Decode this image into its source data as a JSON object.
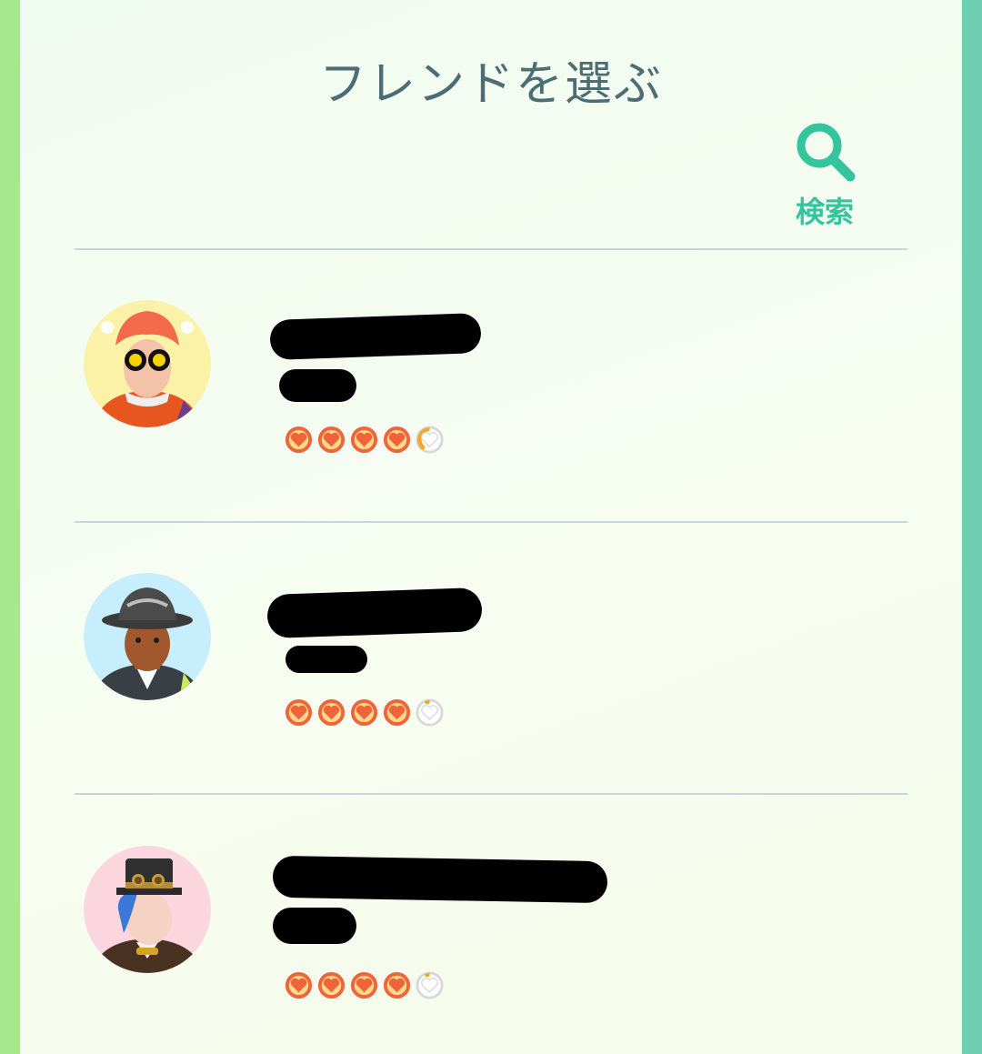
{
  "header": {
    "title": "フレンドを選ぶ",
    "search_label": "検索"
  },
  "friends": [
    {
      "name": "",
      "sub": "",
      "hearts": [
        1,
        1,
        1,
        1,
        0.3
      ],
      "avatar_bg": "#fbf2a8"
    },
    {
      "name": "",
      "sub": "",
      "hearts": [
        1,
        1,
        1,
        1,
        0.1
      ],
      "avatar_bg": "#c6eefc"
    },
    {
      "name": "",
      "sub": "",
      "hearts": [
        1,
        1,
        1,
        1,
        0.1
      ],
      "avatar_bg": "#fcd6de"
    }
  ],
  "colors": {
    "accent": "#35c59d",
    "heart_fill": "#f0643b",
    "heart_inner": "#ffd98a",
    "divider": "#c8d6d6"
  }
}
